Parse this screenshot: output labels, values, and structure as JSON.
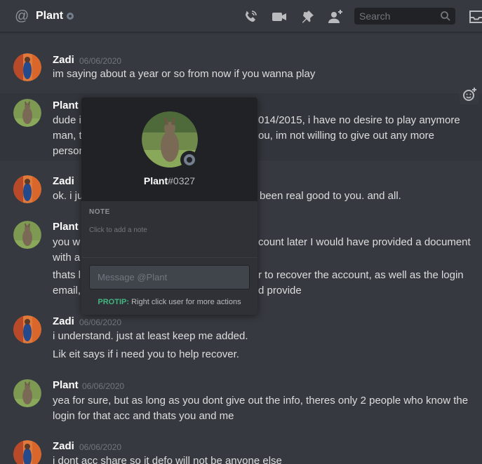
{
  "header": {
    "channel_name": "Plant",
    "search_placeholder": "Search",
    "icons": [
      "at-icon",
      "status-offline-icon",
      "voice-call-icon",
      "video-call-icon",
      "pin-icon",
      "add-friend-icon",
      "search-icon",
      "inbox-icon"
    ]
  },
  "messages": [
    {
      "author": "Zadi",
      "timestamp": "06/06/2020",
      "lines": [
        "im saying about a year or so from now if you wanna play"
      ]
    },
    {
      "author": "Plant",
      "timestamp": "",
      "lines": [
        "dude i",
        "man, t",
        "person"
      ],
      "lines_right": [
        "014/2015, i have no desire to play anymore",
        "ou, im not willing to give out any more"
      ]
    },
    {
      "author": "Zadi",
      "timestamp": "",
      "lines": [
        "ok. i ju"
      ],
      "lines_right": [
        "been real good to you. and all."
      ]
    },
    {
      "author": "Plant",
      "timestamp": "",
      "lines": [
        "you w",
        "with a",
        "thats l",
        "email,"
      ],
      "lines_right": [
        "count later I would have provided a document",
        "r to recover the account, as well as the login",
        "d provide"
      ]
    },
    {
      "author": "Zadi",
      "timestamp": "06/06/2020",
      "lines": [
        "i understand. just at least keep me added.",
        "Lik eit says if i need you to help recover."
      ]
    },
    {
      "author": "Plant",
      "timestamp": "06/06/2020",
      "lines": [
        "yea for sure, but as long as you dont give out the info, theres only 2 people who know the",
        "login for that acc and thats you and me"
      ]
    },
    {
      "author": "Zadi",
      "timestamp": "06/06/2020",
      "lines": [
        "i dont acc share so it defo will not be anyone else"
      ]
    }
  ],
  "popout": {
    "username": "Plant",
    "discriminator": "#0327",
    "note_title": "NOTE",
    "note_placeholder": "Click to add a note",
    "message_placeholder": "Message @Plant",
    "protip_label": "PROTIP:",
    "protip_text": "Right click user for more actions"
  },
  "colors": {
    "background": "#36393f",
    "popout_header": "#202225",
    "popout_body": "#2f3136",
    "protip": "#43b581",
    "offline_status": "#747f8d"
  }
}
